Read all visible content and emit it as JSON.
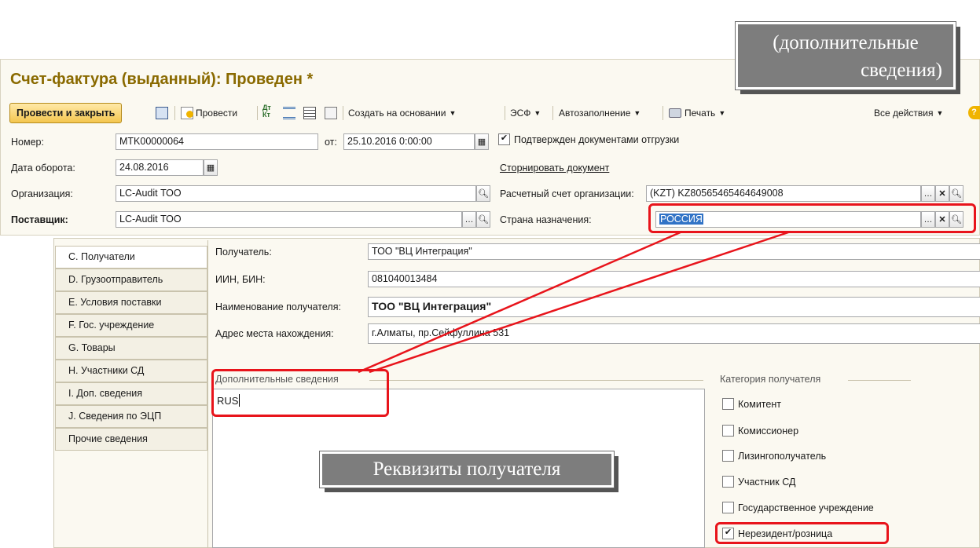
{
  "window": {
    "title": "Счет-фактура (выданный): Проведен *"
  },
  "toolbar": {
    "post_close": "Провести и закрыть",
    "post": "Провести",
    "dtkt": "Дт Кт",
    "create_based": "Создать на основании",
    "esf": "ЭСФ",
    "autofill": "Автозаполнение",
    "print": "Печать",
    "all_actions": "Все действия"
  },
  "header_form": {
    "number_label": "Номер:",
    "number_value": "MTK00000064",
    "from_label": "от:",
    "from_value": "25.10.2016  0:00:00",
    "confirmed_label": "Подтвержден документами отгрузки",
    "turnover_label": "Дата оборота:",
    "turnover_value": "24.08.2016",
    "storno_link": "Сторнировать документ",
    "org_label": "Организация:",
    "org_value": "LC-Audit ТОО",
    "account_label": "Расчетный счет организации:",
    "account_value": "(KZT) KZ80565465464649008",
    "supplier_label": "Поставщик:",
    "supplier_value": "LC-Audit ТОО",
    "country_label": "Страна назначения:",
    "country_value": "РОССИЯ"
  },
  "tabs": [
    "C. Получатели",
    "D. Грузоотправитель",
    "E. Условия поставки",
    "F. Гос. учреждение",
    "G. Товары",
    "H. Участники СД",
    "I. Доп. сведения",
    "J. Сведения по ЭЦП",
    "Прочие сведения"
  ],
  "recipient": {
    "recipient_label": "Получатель:",
    "recipient_value": "ТОО \"ВЦ Интеграция\"",
    "iin_label": "ИИН, БИН:",
    "iin_value": "081040013484",
    "name_label": "Наименование получателя:",
    "name_value": "ТОО \"ВЦ Интеграция\"",
    "address_label": "Адрес места нахождения:",
    "address_value": "г.Алматы, пр.Сейфуллина 531",
    "extra_label": "Дополнительные сведения",
    "extra_value": "RUS"
  },
  "category": {
    "title": "Категория получателя",
    "items": [
      {
        "label": "Комитент",
        "checked": false
      },
      {
        "label": "Комиссионер",
        "checked": false
      },
      {
        "label": "Лизингополучатель",
        "checked": false
      },
      {
        "label": "Участник СД",
        "checked": false
      },
      {
        "label": "Государственное учреждение",
        "checked": false
      },
      {
        "label": "Нерезидент/розница",
        "checked": true
      }
    ]
  },
  "callouts": {
    "top_line1": "(дополнительные",
    "top_line2": "сведения)",
    "bottom": "Реквизиты получателя"
  },
  "colors": {
    "accent_red": "#e8141b",
    "title_brown": "#8a6a00",
    "form_bg": "#fbf9f1",
    "selection_blue": "#3173c6"
  }
}
